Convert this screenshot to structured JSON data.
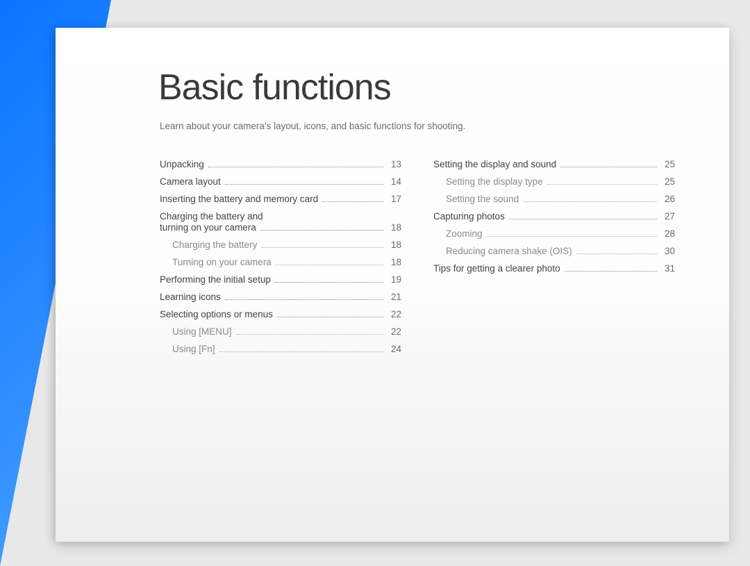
{
  "title": "Basic functions",
  "subtitle": "Learn about your camera’s layout, icons, and basic functions for shooting.",
  "toc": {
    "left": [
      {
        "label": "Unpacking",
        "page": "13",
        "type": "main"
      },
      {
        "label": "Camera layout",
        "page": "14",
        "type": "main"
      },
      {
        "label": "Inserting the battery and memory card",
        "page": "17",
        "type": "main"
      },
      {
        "label_a": "Charging the battery and",
        "label_b": "turning on your camera",
        "page": "18",
        "type": "main-wrap"
      },
      {
        "label": "Charging the battery",
        "page": "18",
        "type": "sub"
      },
      {
        "label": "Turning on your camera",
        "page": "18",
        "type": "sub"
      },
      {
        "label": "Performing the initial setup",
        "page": "19",
        "type": "main"
      },
      {
        "label": "Learning icons",
        "page": "21",
        "type": "main"
      },
      {
        "label": "Selecting options or menus",
        "page": "22",
        "type": "main"
      },
      {
        "label": "Using [MENU]",
        "page": "22",
        "type": "sub"
      },
      {
        "label": "Using [Fn]",
        "page": "24",
        "type": "sub"
      }
    ],
    "right": [
      {
        "label": "Setting the display and sound",
        "page": "25",
        "type": "main"
      },
      {
        "label": "Setting the display type",
        "page": "25",
        "type": "sub"
      },
      {
        "label": "Setting the sound",
        "page": "26",
        "type": "sub"
      },
      {
        "label": "Capturing photos",
        "page": "27",
        "type": "main"
      },
      {
        "label": "Zooming",
        "page": "28",
        "type": "sub"
      },
      {
        "label": "Reducing camera shake (OIS)",
        "page": "30",
        "type": "sub"
      },
      {
        "label": "Tips for getting a clearer photo",
        "page": "31",
        "type": "main"
      }
    ]
  }
}
